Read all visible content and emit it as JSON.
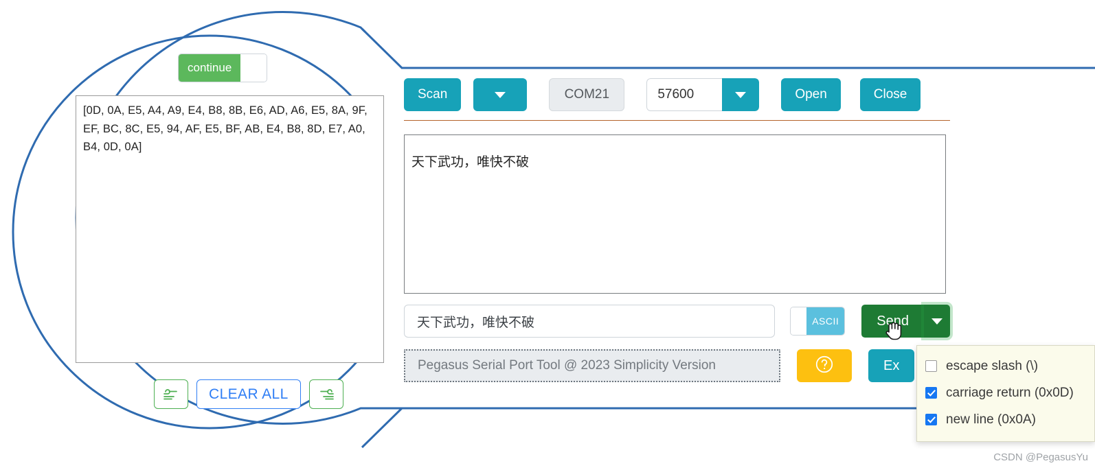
{
  "magnifier": {
    "continue_toggle": {
      "label": "continue",
      "state": "on"
    },
    "hex_output": "[0D, 0A, E5, A4, A9, E4, B8, 8B, E6, AD, A6, E5, 8A, 9F, EF, BC, 8C, E5, 94, AF, E5, BF, AB, E4, B8, 8D, E7, A0, B4, 0D, 0A]",
    "buttons": {
      "clear_left_icon": "wind-left-icon",
      "clear_all_label": "CLEAR ALL",
      "clear_right_icon": "wind-right-icon"
    }
  },
  "toolbar": {
    "scan_label": "Scan",
    "port_dropdown_icon": "chevron-down-icon",
    "com_port": "COM21",
    "baud_rate": "57600",
    "baud_dropdown_icon": "chevron-down-icon",
    "open_label": "Open",
    "close_label": "Close"
  },
  "receive": {
    "text": "天下武功，唯快不破"
  },
  "send": {
    "input_value": "天下武功，唯快不破",
    "format_toggle": {
      "label": "ASCII",
      "state": "on"
    },
    "send_label": "Send",
    "send_dropdown_icon": "chevron-down-icon"
  },
  "footer": {
    "info_text": "Pegasus Serial Port Tool @ 2023 Simplicity Version",
    "help_icon": "question-circle-icon",
    "export_label": "Ex"
  },
  "dropdown": {
    "items": [
      {
        "label": "escape slash (\\)",
        "checked": false
      },
      {
        "label": "carriage return (0x0D)",
        "checked": true
      },
      {
        "label": "new line (0x0A)",
        "checked": true
      }
    ]
  },
  "watermark": "CSDN @PegasusYu",
  "colors": {
    "teal": "#17a2b8",
    "green_send": "#1e7b34",
    "green_toggle": "#5cb85c",
    "blue_callout": "#2f6bb0",
    "blue_clear": "#2f7ef5",
    "yellow_help": "#fdc010",
    "ascii_blue": "#5bc0de",
    "divider_brown": "#b5622a"
  }
}
